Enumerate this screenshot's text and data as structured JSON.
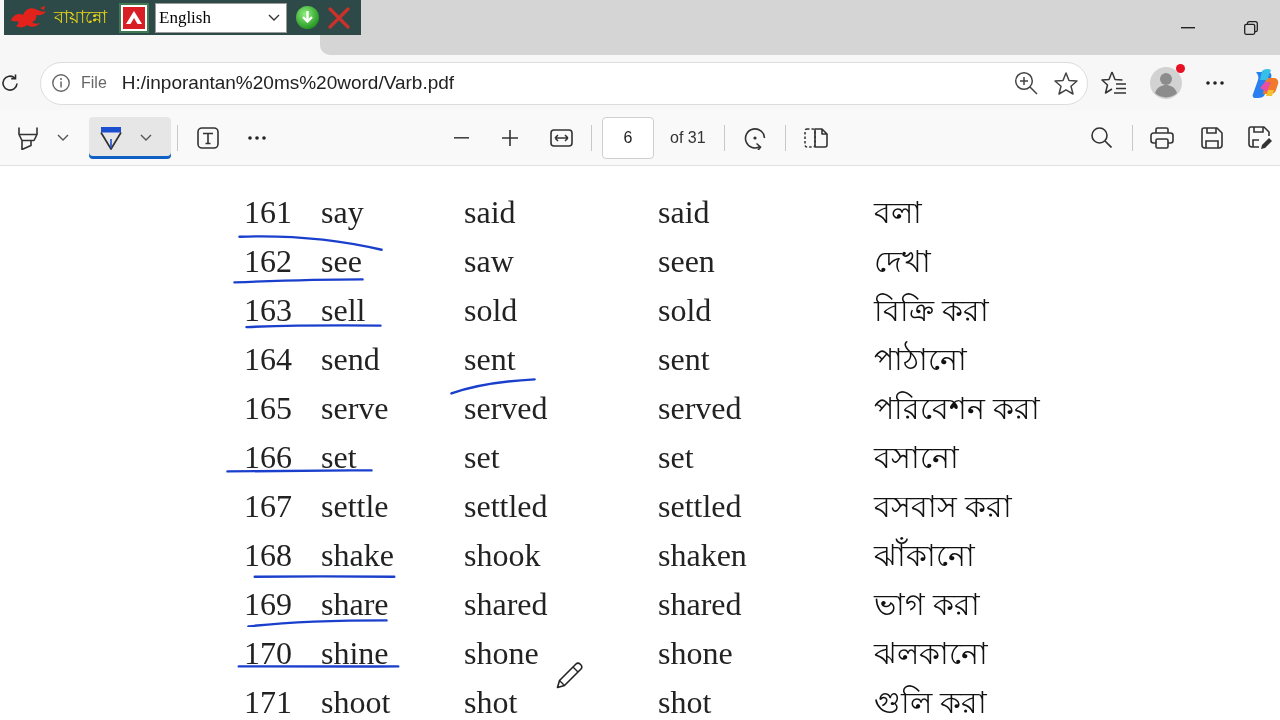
{
  "keyboard_bar": {
    "app_name": "বায়ান্নো",
    "language": "English"
  },
  "address_bar": {
    "scheme": "File",
    "url": "H:/inporantan%20ms%20word/Varb.pdf"
  },
  "profile": {
    "notification": true
  },
  "pdf_toolbar": {
    "tools": [
      {
        "kind": "highlight",
        "selected": false
      },
      {
        "kind": "draw",
        "selected": true
      }
    ],
    "page": "6",
    "page_count": "of 31"
  },
  "table": {
    "rows": [
      {
        "number": "161",
        "verb": "say",
        "past": "said",
        "participle": "said",
        "meaning": "বলা",
        "verb_underlined": true,
        "past_underlined": false
      },
      {
        "number": "162",
        "verb": "see",
        "past": "saw",
        "participle": "seen",
        "meaning": "দেখা",
        "verb_underlined": true,
        "past_underlined": false
      },
      {
        "number": "163",
        "verb": "sell",
        "past": "sold",
        "participle": "sold",
        "meaning": "বিক্রি করা",
        "verb_underlined": true,
        "past_underlined": false
      },
      {
        "number": "164",
        "verb": "send",
        "past": "sent",
        "participle": "sent",
        "meaning": "পাঠানো",
        "verb_underlined": false,
        "past_underlined": true
      },
      {
        "number": "165",
        "verb": "serve",
        "past": "served",
        "participle": "served",
        "meaning": "পরিবেশন করা",
        "verb_underlined": false,
        "past_underlined": false
      },
      {
        "number": "166",
        "verb": "set",
        "past": "set",
        "participle": "set",
        "meaning": "বসানো",
        "verb_underlined": true,
        "past_underlined": false
      },
      {
        "number": "167",
        "verb": "settle",
        "past": "settled",
        "participle": "settled",
        "meaning": "বসবাস করা",
        "verb_underlined": false,
        "past_underlined": false
      },
      {
        "number": "168",
        "verb": "shake",
        "past": "shook",
        "participle": "shaken",
        "meaning": "ঝাঁকানো",
        "verb_underlined": true,
        "past_underlined": false
      },
      {
        "number": "169",
        "verb": "share",
        "past": "shared",
        "participle": "shared",
        "meaning": "ভাগ করা",
        "verb_underlined": true,
        "past_underlined": false
      },
      {
        "number": "170",
        "verb": "shine",
        "past": "shone",
        "participle": "shone",
        "meaning": "ঝলকানো",
        "verb_underlined": true,
        "past_underlined": false
      },
      {
        "number": "171",
        "verb": "shoot",
        "past": "shot",
        "participle": "shot",
        "meaning": "গুলি করা",
        "verb_underlined": false,
        "past_underlined": false
      }
    ]
  }
}
